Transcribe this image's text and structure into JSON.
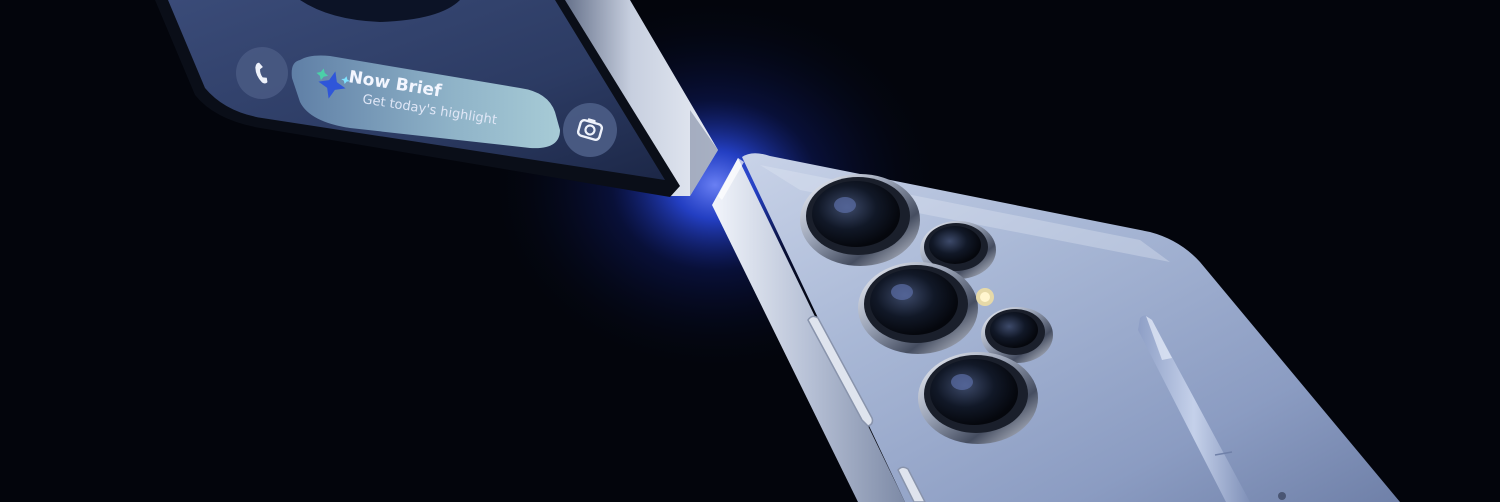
{
  "now_brief": {
    "title": "Now Brief",
    "subtitle": "Get today's highlight"
  },
  "colors": {
    "background": "#03050c",
    "glow": "#2a4dff",
    "phone_body": "#a9b8d6",
    "screen": "#2c3b63",
    "pill": "#8fb3c8"
  },
  "icons": {
    "left_shortcut": "phone-icon",
    "right_shortcut": "camera-icon",
    "brief_badge": "sparkle-stars-icon"
  }
}
